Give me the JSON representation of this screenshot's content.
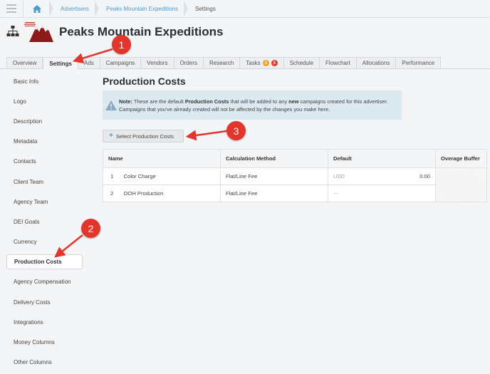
{
  "breadcrumb": {
    "home_icon": "home-icon",
    "items": [
      "Advertisers",
      "Peaks Mountain Expeditions",
      "Settings"
    ]
  },
  "header": {
    "org_icon": "sitemap-icon",
    "logo": "peaks-mountain-logo",
    "title": "Peaks Mountain Expeditions"
  },
  "tabs": [
    {
      "label": "Overview"
    },
    {
      "label": "Settings",
      "active": true
    },
    {
      "label": "Ads"
    },
    {
      "label": "Campaigns"
    },
    {
      "label": "Vendors"
    },
    {
      "label": "Orders"
    },
    {
      "label": "Research"
    },
    {
      "label": "Tasks",
      "badges": [
        {
          "value": "3",
          "color": "#f0a020"
        },
        {
          "value": "3",
          "color": "#e2352c"
        }
      ]
    },
    {
      "label": "Schedule"
    },
    {
      "label": "Flowchart"
    },
    {
      "label": "Allocations"
    },
    {
      "label": "Performance"
    }
  ],
  "sidebar": {
    "items": [
      {
        "label": "Basic Info"
      },
      {
        "label": "Logo"
      },
      {
        "label": "Description"
      },
      {
        "label": "Metadata"
      },
      {
        "label": "Contacts"
      },
      {
        "label": "Client Team"
      },
      {
        "label": "Agency Team"
      },
      {
        "label": "DEI Goals"
      },
      {
        "label": "Currency"
      },
      {
        "label": "Production Costs",
        "active": true
      },
      {
        "label": "Agency Compensation"
      },
      {
        "label": "Delivery Costs"
      },
      {
        "label": "Integrations"
      },
      {
        "label": "Money Columns"
      },
      {
        "label": "Other Columns"
      }
    ]
  },
  "main": {
    "title": "Production Costs",
    "note": {
      "icon": "warning-icon",
      "label": "Note:",
      "text1": " These are the default ",
      "bold1": "Production Costs",
      "text2": " that will be added to any ",
      "bold2": "new",
      "text3": " campaigns created for this advertiser. Campaigns that you've already created will not be affected by the changes you make here."
    },
    "select_button": {
      "icon": "+",
      "label": "Select Production Costs"
    },
    "table": {
      "columns": [
        "Name",
        "Calculation Method",
        "Default",
        "Overage Buffer"
      ],
      "rows": [
        {
          "num": "1",
          "name": "Color Charge",
          "method": "Flat/Line Fee",
          "currency": "USD",
          "default": "0.00"
        },
        {
          "num": "2",
          "name": "OOH Production",
          "method": "Flat/Line Fee",
          "currency": "---",
          "default": ""
        }
      ]
    }
  },
  "annotations": [
    {
      "number": "1",
      "target": "Settings tab"
    },
    {
      "number": "2",
      "target": "Production Costs sidebar item"
    },
    {
      "number": "3",
      "target": "Select Production Costs button"
    }
  ],
  "colors": {
    "link": "#4a9bd0",
    "annotation_red": "#e2352c",
    "note_bg": "#dde9f0",
    "logo_red": "#8b1a1a"
  }
}
